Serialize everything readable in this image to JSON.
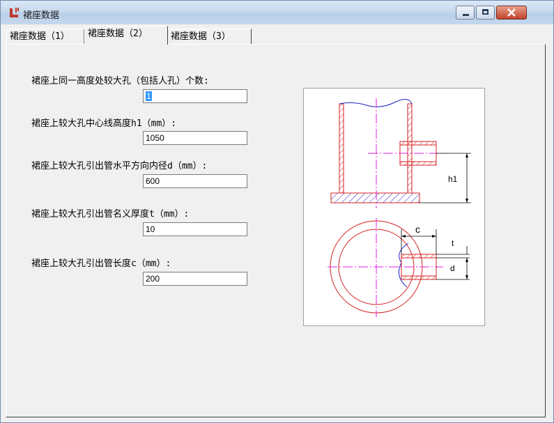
{
  "window": {
    "title": "裙座数据",
    "icon": "app-logo-icon"
  },
  "tabs": [
    {
      "label": "裙座数据（1）"
    },
    {
      "label": "裙座数据（2）",
      "active": true
    },
    {
      "label": "裙座数据（3）"
    }
  ],
  "fields": [
    {
      "label": "裙座上同一高度处较大孔（包括人孔）个数:",
      "value": "1"
    },
    {
      "label": "裙座上较大孔中心线高度h1（mm）:",
      "value": "1050"
    },
    {
      "label": "裙座上较大孔引出管水平方向内径d（mm）:",
      "value": "600"
    },
    {
      "label": "裙座上较大孔引出管名义厚度t（mm）:",
      "value": "10"
    },
    {
      "label": "裙座上较大孔引出管长度c（mm）:",
      "value": "200"
    }
  ],
  "diagram": {
    "labels": {
      "h1": "h1",
      "c": "c",
      "t": "t",
      "d": "d"
    }
  }
}
